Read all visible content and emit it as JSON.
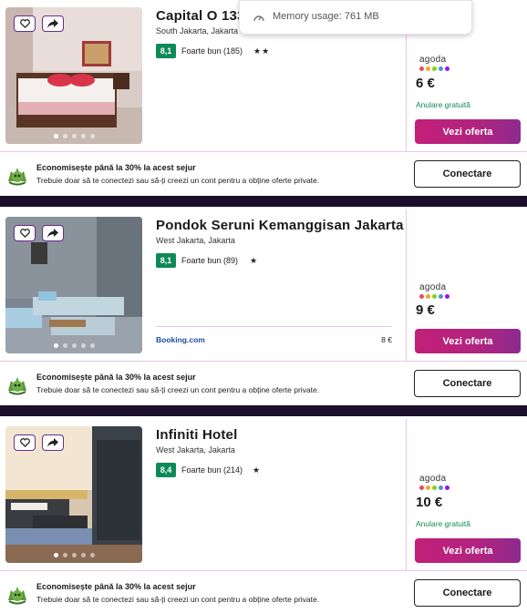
{
  "tooltip": {
    "label": "Memory usage: 761 MB"
  },
  "listings": [
    {
      "name": "Capital O 133",
      "location": "South Jakarta, Jakarta",
      "score": "8,1",
      "review": "Foarte bun (185)",
      "stars": "★★",
      "provider": "agoda",
      "price": "6 €",
      "cancel": "Anulare gratuită",
      "cta": "Vezi oferta",
      "secondary": null
    },
    {
      "name": "Pondok Seruni Kemanggisan Jakarta",
      "location": "West Jakarta, Jakarta",
      "score": "8,1",
      "review": "Foarte bun (89)",
      "stars": "★",
      "provider": "agoda",
      "price": "9 €",
      "cancel": "",
      "cta": "Vezi oferta",
      "secondary": {
        "name": "Booking.com",
        "price": "8 €"
      }
    },
    {
      "name": "Infiniti Hotel",
      "location": "West Jakarta, Jakarta",
      "score": "8,4",
      "review": "Foarte bun (214)",
      "stars": "★",
      "provider": "agoda",
      "price": "10 €",
      "cancel": "Anulare gratuită",
      "cta": "Vezi oferta",
      "secondary": null
    }
  ],
  "promo": {
    "title": "Economisește până la 30% la acest sejur",
    "subtitle": "Trebuie doar să te conectezi sau să-ți creezi un cont pentru a obține oferte private.",
    "button": "Conectare"
  },
  "colors": {
    "score_green": "#0e8a56",
    "cta_pink": "#c21f78",
    "divider_dark": "#1c0f2a",
    "agoda_dots": [
      "#e84a5f",
      "#f5a623",
      "#7ed321",
      "#4a90e2",
      "#9013fe"
    ]
  }
}
